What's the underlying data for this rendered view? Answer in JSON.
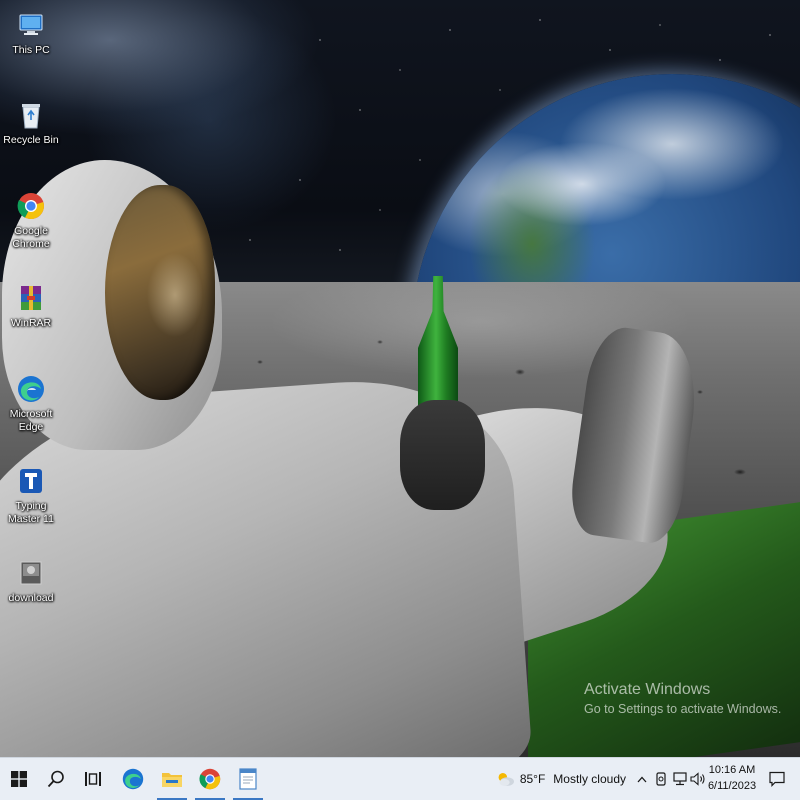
{
  "desktop": {
    "icons": [
      {
        "label": "This PC",
        "icon": "this-pc-icon"
      },
      {
        "label": "Recycle Bin",
        "icon": "recycle-bin-icon"
      },
      {
        "label": "Google Chrome",
        "icon": "chrome-icon"
      },
      {
        "label": "WinRAR",
        "icon": "winrar-icon"
      },
      {
        "label": "Microsoft Edge",
        "icon": "edge-icon"
      },
      {
        "label": "Typing Master 11",
        "icon": "typing-master-icon"
      },
      {
        "label": "download",
        "icon": "download-file-icon"
      }
    ]
  },
  "watermark": {
    "title": "Activate Windows",
    "subtitle": "Go to Settings to activate Windows."
  },
  "taskbar": {
    "pinned": [
      "start-icon",
      "search-icon",
      "task-view-icon",
      "edge-icon",
      "file-explorer-icon",
      "chrome-icon",
      "notepad-app-icon"
    ],
    "weather": {
      "temperature": "85°F",
      "condition": "Mostly cloudy"
    },
    "tray_icons": [
      "show-hidden-icons-chevron",
      "meet-now-icon",
      "network-icon",
      "volume-icon"
    ],
    "clock": {
      "time": "10:16 AM",
      "date": "6/11/2023"
    },
    "notification_icon": "action-center-icon"
  },
  "colors": {
    "taskbar_bg": "#e9eef5",
    "active_indicator": "#3b78c4"
  }
}
